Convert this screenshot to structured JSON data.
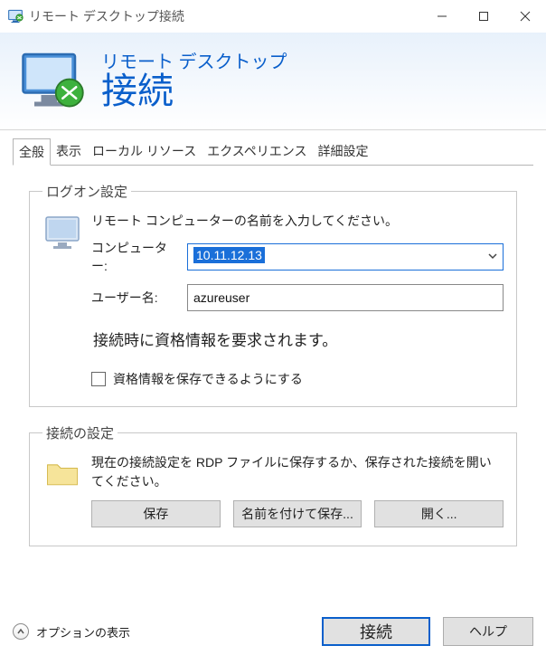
{
  "window": {
    "title": "リモート デスクトップ接続"
  },
  "banner": {
    "subtitle": "リモート デスクトップ",
    "title": "接続"
  },
  "tabs": [
    {
      "label": "全般"
    },
    {
      "label": "表示"
    },
    {
      "label": "ローカル リソース"
    },
    {
      "label": "エクスペリエンス"
    },
    {
      "label": "詳細設定"
    }
  ],
  "logon": {
    "legend": "ログオン設定",
    "instruction": "リモート コンピューターの名前を入力してください。",
    "computer_label": "コンピューター:",
    "computer_value": "10.11.12.13",
    "username_label": "ユーザー名:",
    "username_value": "azureuser",
    "cred_prompt": "接続時に資格情報を要求されます。",
    "save_creds_label": "資格情報を保存できるようにする"
  },
  "connection_settings": {
    "legend": "接続の設定",
    "description": "現在の接続設定を RDP ファイルに保存するか、保存された接続を開いてください。",
    "save": "保存",
    "save_as": "名前を付けて保存...",
    "open": "開く..."
  },
  "footer": {
    "options_toggle": "オプションの表示",
    "connect": "接続",
    "help": "ヘルプ"
  }
}
